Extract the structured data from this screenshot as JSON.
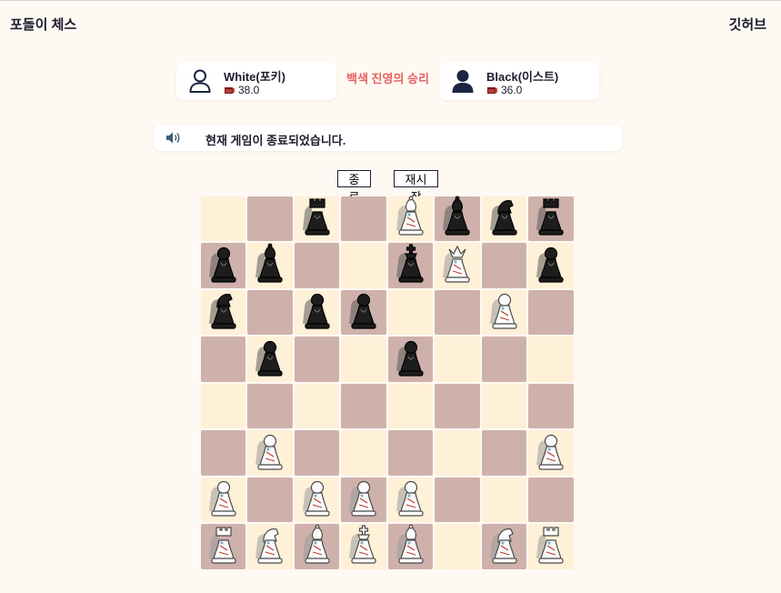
{
  "header": {
    "title": "포돌이 체스",
    "github_label": "깃허브"
  },
  "players": {
    "white": {
      "name": "White(포키)",
      "score": "38.0",
      "avatar_icon": "user-outline-icon"
    },
    "black": {
      "name": "Black(이스트)",
      "score": "36.0",
      "avatar_icon": "user-filled-icon"
    }
  },
  "result_text": "백색 진영의 승리",
  "status": {
    "text": "현재 게임이 종료되었습니다.",
    "icon": "speaker-icon"
  },
  "buttons": {
    "end_label": "종료",
    "restart_label": "재시작"
  },
  "colors": {
    "accent": "#e8605f",
    "dark_square": "#cfb1ab",
    "light_square": "#fff0d8"
  },
  "board": [
    [
      "",
      "",
      "bR",
      "",
      "wB",
      "bB",
      "bN",
      "bR"
    ],
    [
      "bP",
      "bB",
      "",
      "",
      "bK",
      "wQ",
      "",
      "bP"
    ],
    [
      "bN",
      "",
      "bP",
      "bP",
      "",
      "",
      "wP",
      ""
    ],
    [
      "",
      "bP",
      "",
      "",
      "bP",
      "",
      "",
      ""
    ],
    [
      "",
      "",
      "",
      "",
      "",
      "",
      "",
      ""
    ],
    [
      "",
      "wP",
      "",
      "",
      "",
      "",
      "",
      "wP"
    ],
    [
      "wP",
      "",
      "wP",
      "wP",
      "wP",
      "",
      "",
      ""
    ],
    [
      "wR",
      "wN",
      "wB",
      "wK",
      "wB",
      "",
      "wN",
      "wR"
    ]
  ]
}
